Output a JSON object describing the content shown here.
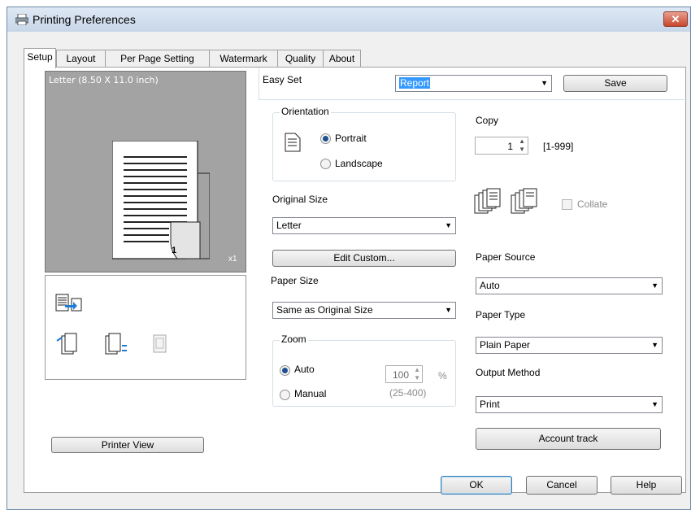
{
  "window": {
    "title": "Printing Preferences"
  },
  "tabs": [
    {
      "label": "Setup"
    },
    {
      "label": "Layout"
    },
    {
      "label": "Per Page Setting"
    },
    {
      "label": "Watermark"
    },
    {
      "label": "Quality"
    },
    {
      "label": "About"
    }
  ],
  "preview": {
    "paper_label": "Letter  (8.50 X 11.0 inch)",
    "page_number": "1",
    "copies_marker": "x1",
    "printer_view_label": "Printer View"
  },
  "easy_set": {
    "label": "Easy Set",
    "value": "Report",
    "save_label": "Save"
  },
  "orientation": {
    "title": "Orientation",
    "portrait": "Portrait",
    "landscape": "Landscape",
    "selected": "Portrait"
  },
  "original_size": {
    "label": "Original Size",
    "value": "Letter",
    "edit_custom_label": "Edit Custom..."
  },
  "paper_size": {
    "label": "Paper Size",
    "value": "Same as Original Size"
  },
  "zoom": {
    "title": "Zoom",
    "auto": "Auto",
    "manual": "Manual",
    "selected": "Auto",
    "value": "100",
    "unit": "%",
    "range": "(25-400)"
  },
  "copy": {
    "label": "Copy",
    "value": "1",
    "range": "[1-999]",
    "collate_label": "Collate",
    "collate_checked": false
  },
  "paper_source": {
    "label": "Paper Source",
    "value": "Auto"
  },
  "paper_type": {
    "label": "Paper Type",
    "value": "Plain Paper"
  },
  "output_method": {
    "label": "Output Method",
    "value": "Print",
    "account_track_label": "Account track"
  },
  "dialog_buttons": {
    "ok": "OK",
    "cancel": "Cancel",
    "help": "Help"
  },
  "colors": {
    "accent": "#3399ff",
    "title_bg": "#cfdcea",
    "preview_bg": "#a3a3a3",
    "close_red": "#c8452b"
  }
}
